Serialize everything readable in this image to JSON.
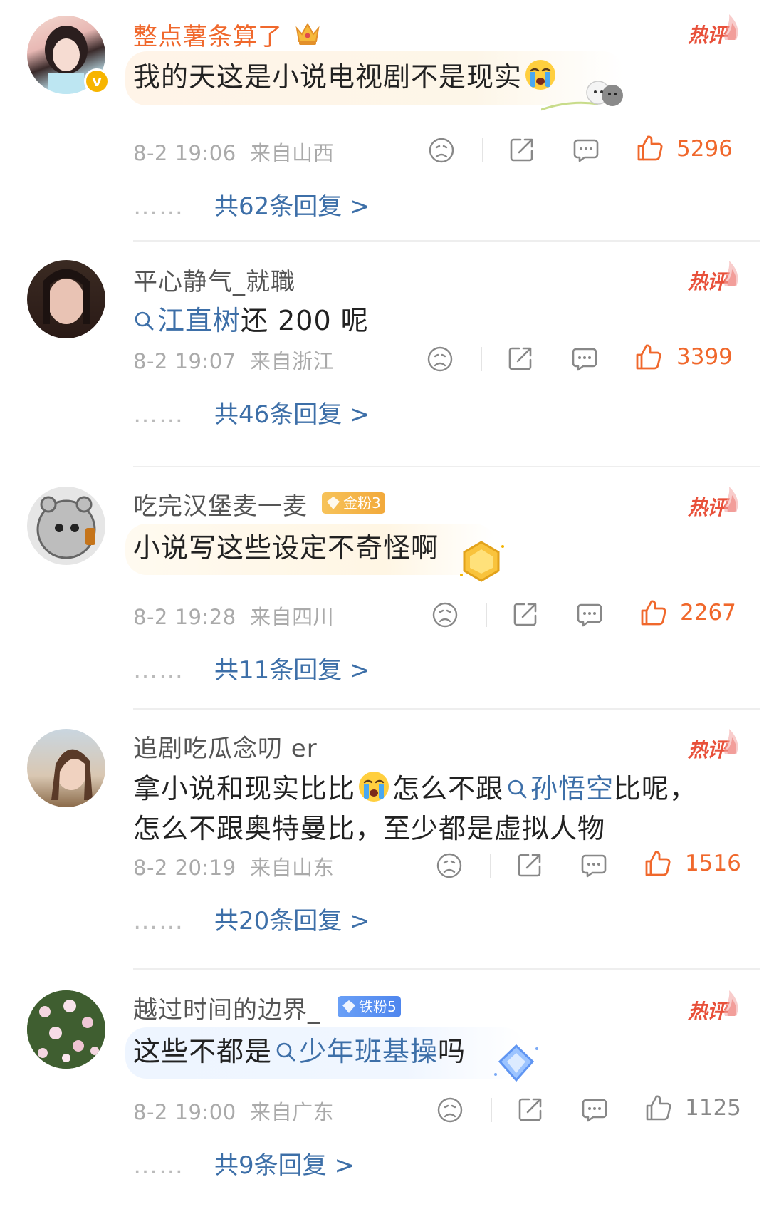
{
  "comments": [
    {
      "username": "整点薯条算了",
      "hot_label": "热评",
      "text": "我的天这是小说电视剧不是现实",
      "date": "8-2 19:06",
      "location": "来自山西",
      "likes": "5296",
      "replies": "共62条回复 >",
      "reply_dots": "……"
    },
    {
      "username": "平心静气_就職",
      "hot_label": "热评",
      "text_topic": "江直树",
      "text_rest": "还 200 呢",
      "date": "8-2 19:07",
      "location": "来自浙江",
      "likes": "3399",
      "replies": "共46条回复 >",
      "reply_dots": "……"
    },
    {
      "username": "吃完汉堡麦一麦",
      "badge": "金粉3",
      "hot_label": "热评",
      "text": "小说写这些设定不奇怪啊",
      "date": "8-2 19:28",
      "location": "来自四川",
      "likes": "2267",
      "replies": "共11条回复 >",
      "reply_dots": "……"
    },
    {
      "username": "追剧吃瓜念叨 er",
      "hot_label": "热评",
      "text_part1": "拿小说和现实比比",
      "text_part2": "怎么不跟",
      "text_topic": "孙悟空",
      "text_part3": "比呢，",
      "text_line2": "怎么不跟奥特曼比，至少都是虚拟人物",
      "date": "8-2 20:19",
      "location": "来自山东",
      "likes": "1516",
      "replies": "共20条回复 >",
      "reply_dots": "……"
    },
    {
      "username": "越过时间的边界_",
      "badge": "铁粉5",
      "hot_label": "热评",
      "text_prefix": "这些不都是",
      "text_topic": "少年班基操",
      "text_suffix": "吗",
      "date": "8-2 19:00",
      "location": "来自广东",
      "likes": "1125",
      "replies": "共9条回复 >",
      "reply_dots": "……"
    }
  ],
  "colors": {
    "accent_orange": "#f0682c",
    "hot_red": "#e8503a",
    "link_blue": "#3d6fa8",
    "meta_gray": "#aaaaaa",
    "gold_badge": "#f5b640",
    "iron_badge": "#5b8ff0"
  },
  "icons": [
    "dislike-face-icon",
    "share-icon",
    "comment-icon",
    "like-thumb-icon",
    "search-icon",
    "crown-icon",
    "crying-emoji-icon",
    "verified-icon"
  ]
}
